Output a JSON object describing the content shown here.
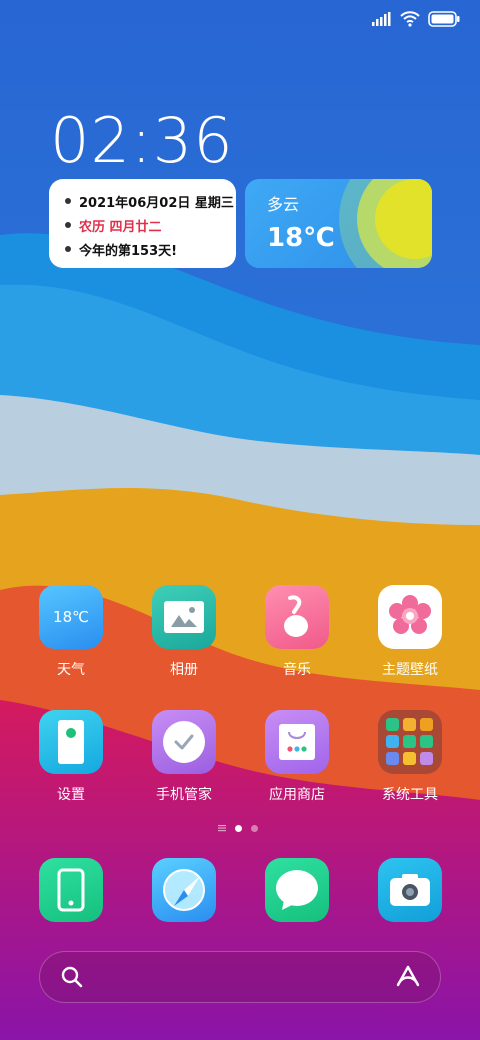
{
  "status_bar": {
    "signal_icon": "signal-icon",
    "wifi_icon": "wifi-icon",
    "battery_icon": "battery-icon"
  },
  "clock": {
    "time": "02:36"
  },
  "date_widget": {
    "line1": "2021年06月02日 星期三",
    "line2": "农历 四月廿二",
    "line3": "今年的第153天!"
  },
  "weather_widget": {
    "condition": "多云",
    "temperature": "18℃"
  },
  "apps_row1": [
    {
      "label": "天气",
      "icon": "weather-icon",
      "icon_text": "18℃"
    },
    {
      "label": "相册",
      "icon": "gallery-icon"
    },
    {
      "label": "音乐",
      "icon": "music-icon"
    },
    {
      "label": "主题壁纸",
      "icon": "theme-icon"
    }
  ],
  "apps_row2": [
    {
      "label": "设置",
      "icon": "settings-icon"
    },
    {
      "label": "手机管家",
      "icon": "phone-manager-icon"
    },
    {
      "label": "应用商店",
      "icon": "app-store-icon"
    },
    {
      "label": "系统工具",
      "icon": "folder-icon"
    }
  ],
  "page_indicator": {
    "pages": 2,
    "current": 0
  },
  "dock": [
    {
      "icon": "phone-icon"
    },
    {
      "icon": "browser-icon"
    },
    {
      "icon": "messages-icon"
    },
    {
      "icon": "camera-icon"
    }
  ],
  "search_bar": {
    "search_icon": "search-icon",
    "assistant_icon": "assistant-icon"
  },
  "colors": {
    "sky": "#2a6fd6",
    "date_red": "#e0304a",
    "weather_bg": "#3fa9f5"
  }
}
